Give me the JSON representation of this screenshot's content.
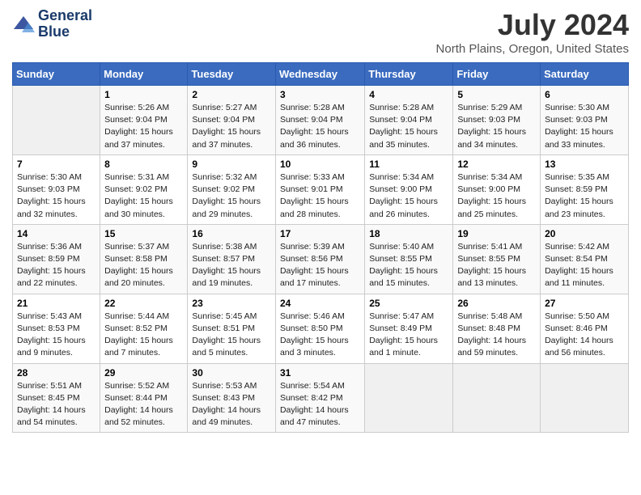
{
  "logo": {
    "line1": "General",
    "line2": "Blue"
  },
  "title": "July 2024",
  "subtitle": "North Plains, Oregon, United States",
  "header": {
    "days": [
      "Sunday",
      "Monday",
      "Tuesday",
      "Wednesday",
      "Thursday",
      "Friday",
      "Saturday"
    ]
  },
  "weeks": [
    [
      {
        "day": "",
        "info": ""
      },
      {
        "day": "1",
        "info": "Sunrise: 5:26 AM\nSunset: 9:04 PM\nDaylight: 15 hours\nand 37 minutes."
      },
      {
        "day": "2",
        "info": "Sunrise: 5:27 AM\nSunset: 9:04 PM\nDaylight: 15 hours\nand 37 minutes."
      },
      {
        "day": "3",
        "info": "Sunrise: 5:28 AM\nSunset: 9:04 PM\nDaylight: 15 hours\nand 36 minutes."
      },
      {
        "day": "4",
        "info": "Sunrise: 5:28 AM\nSunset: 9:04 PM\nDaylight: 15 hours\nand 35 minutes."
      },
      {
        "day": "5",
        "info": "Sunrise: 5:29 AM\nSunset: 9:03 PM\nDaylight: 15 hours\nand 34 minutes."
      },
      {
        "day": "6",
        "info": "Sunrise: 5:30 AM\nSunset: 9:03 PM\nDaylight: 15 hours\nand 33 minutes."
      }
    ],
    [
      {
        "day": "7",
        "info": "Sunrise: 5:30 AM\nSunset: 9:03 PM\nDaylight: 15 hours\nand 32 minutes."
      },
      {
        "day": "8",
        "info": "Sunrise: 5:31 AM\nSunset: 9:02 PM\nDaylight: 15 hours\nand 30 minutes."
      },
      {
        "day": "9",
        "info": "Sunrise: 5:32 AM\nSunset: 9:02 PM\nDaylight: 15 hours\nand 29 minutes."
      },
      {
        "day": "10",
        "info": "Sunrise: 5:33 AM\nSunset: 9:01 PM\nDaylight: 15 hours\nand 28 minutes."
      },
      {
        "day": "11",
        "info": "Sunrise: 5:34 AM\nSunset: 9:00 PM\nDaylight: 15 hours\nand 26 minutes."
      },
      {
        "day": "12",
        "info": "Sunrise: 5:34 AM\nSunset: 9:00 PM\nDaylight: 15 hours\nand 25 minutes."
      },
      {
        "day": "13",
        "info": "Sunrise: 5:35 AM\nSunset: 8:59 PM\nDaylight: 15 hours\nand 23 minutes."
      }
    ],
    [
      {
        "day": "14",
        "info": "Sunrise: 5:36 AM\nSunset: 8:59 PM\nDaylight: 15 hours\nand 22 minutes."
      },
      {
        "day": "15",
        "info": "Sunrise: 5:37 AM\nSunset: 8:58 PM\nDaylight: 15 hours\nand 20 minutes."
      },
      {
        "day": "16",
        "info": "Sunrise: 5:38 AM\nSunset: 8:57 PM\nDaylight: 15 hours\nand 19 minutes."
      },
      {
        "day": "17",
        "info": "Sunrise: 5:39 AM\nSunset: 8:56 PM\nDaylight: 15 hours\nand 17 minutes."
      },
      {
        "day": "18",
        "info": "Sunrise: 5:40 AM\nSunset: 8:55 PM\nDaylight: 15 hours\nand 15 minutes."
      },
      {
        "day": "19",
        "info": "Sunrise: 5:41 AM\nSunset: 8:55 PM\nDaylight: 15 hours\nand 13 minutes."
      },
      {
        "day": "20",
        "info": "Sunrise: 5:42 AM\nSunset: 8:54 PM\nDaylight: 15 hours\nand 11 minutes."
      }
    ],
    [
      {
        "day": "21",
        "info": "Sunrise: 5:43 AM\nSunset: 8:53 PM\nDaylight: 15 hours\nand 9 minutes."
      },
      {
        "day": "22",
        "info": "Sunrise: 5:44 AM\nSunset: 8:52 PM\nDaylight: 15 hours\nand 7 minutes."
      },
      {
        "day": "23",
        "info": "Sunrise: 5:45 AM\nSunset: 8:51 PM\nDaylight: 15 hours\nand 5 minutes."
      },
      {
        "day": "24",
        "info": "Sunrise: 5:46 AM\nSunset: 8:50 PM\nDaylight: 15 hours\nand 3 minutes."
      },
      {
        "day": "25",
        "info": "Sunrise: 5:47 AM\nSunset: 8:49 PM\nDaylight: 15 hours\nand 1 minute."
      },
      {
        "day": "26",
        "info": "Sunrise: 5:48 AM\nSunset: 8:48 PM\nDaylight: 14 hours\nand 59 minutes."
      },
      {
        "day": "27",
        "info": "Sunrise: 5:50 AM\nSunset: 8:46 PM\nDaylight: 14 hours\nand 56 minutes."
      }
    ],
    [
      {
        "day": "28",
        "info": "Sunrise: 5:51 AM\nSunset: 8:45 PM\nDaylight: 14 hours\nand 54 minutes."
      },
      {
        "day": "29",
        "info": "Sunrise: 5:52 AM\nSunset: 8:44 PM\nDaylight: 14 hours\nand 52 minutes."
      },
      {
        "day": "30",
        "info": "Sunrise: 5:53 AM\nSunset: 8:43 PM\nDaylight: 14 hours\nand 49 minutes."
      },
      {
        "day": "31",
        "info": "Sunrise: 5:54 AM\nSunset: 8:42 PM\nDaylight: 14 hours\nand 47 minutes."
      },
      {
        "day": "",
        "info": ""
      },
      {
        "day": "",
        "info": ""
      },
      {
        "day": "",
        "info": ""
      }
    ]
  ]
}
